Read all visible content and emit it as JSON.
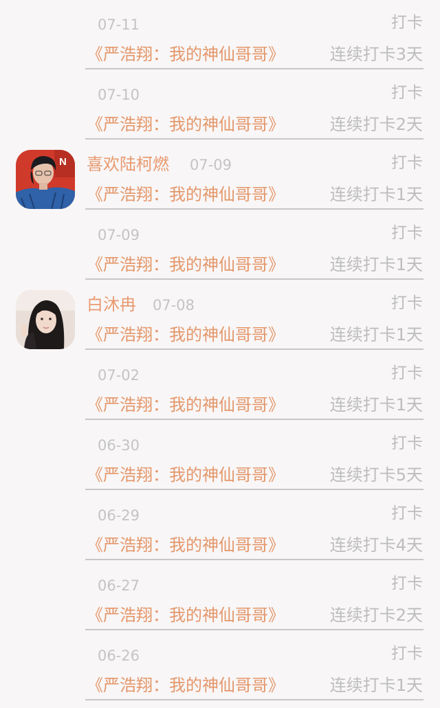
{
  "feed": {
    "entries": [
      {
        "user_name": "",
        "date": "07-11",
        "action": "打卡",
        "book_title": "《严浩翔：我的神仙哥哥》",
        "streak": "连续打卡3天"
      },
      {
        "user_name": "",
        "date": "07-10",
        "action": "打卡",
        "book_title": "《严浩翔：我的神仙哥哥》",
        "streak": "连续打卡2天"
      },
      {
        "user_name": "喜欢陆柯燃",
        "date": "07-09",
        "action": "打卡",
        "book_title": "《严浩翔：我的神仙哥哥》",
        "streak": "连续打卡1天"
      },
      {
        "user_name": "",
        "date": "07-09",
        "action": "打卡",
        "book_title": "《严浩翔：我的神仙哥哥》",
        "streak": "连续打卡1天"
      },
      {
        "user_name": "白沐冉",
        "date": "07-08",
        "action": "打卡",
        "book_title": "《严浩翔：我的神仙哥哥》",
        "streak": "连续打卡1天"
      },
      {
        "user_name": "",
        "date": "07-02",
        "action": "打卡",
        "book_title": "《严浩翔：我的神仙哥哥》",
        "streak": "连续打卡1天"
      },
      {
        "user_name": "",
        "date": "06-30",
        "action": "打卡",
        "book_title": "《严浩翔：我的神仙哥哥》",
        "streak": "连续打卡5天"
      },
      {
        "user_name": "",
        "date": "06-29",
        "action": "打卡",
        "book_title": "《严浩翔：我的神仙哥哥》",
        "streak": "连续打卡4天"
      },
      {
        "user_name": "",
        "date": "06-27",
        "action": "打卡",
        "book_title": "《严浩翔：我的神仙哥哥》",
        "streak": "连续打卡2天"
      },
      {
        "user_name": "",
        "date": "06-26",
        "action": "打卡",
        "book_title": "《严浩翔：我的神仙哥哥》",
        "streak": "连续打卡1天"
      }
    ]
  },
  "avatars": {
    "avatar_1": {
      "image_lettering": "N",
      "bg_color": "#d03a2b",
      "accent_color": "#2f62a8"
    },
    "avatar_2": {
      "bg_color": "#e9ded8",
      "accent_color": "#1e1a1a"
    }
  },
  "colors": {
    "title_accent": "#e4976a",
    "user_name": "#e99a70",
    "secondary_text": "#bdbdbd",
    "divider": "#c9c6c7",
    "background": "#f8f6f7"
  }
}
